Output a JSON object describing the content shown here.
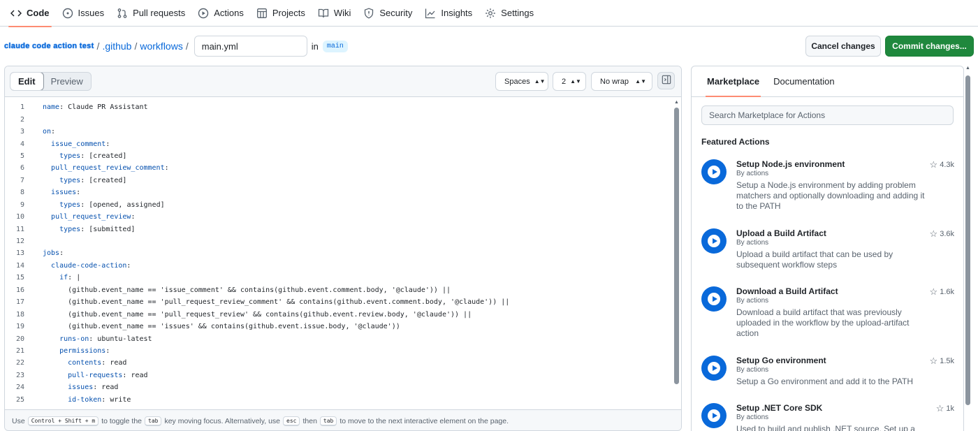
{
  "repo_nav": [
    {
      "label": "Code",
      "icon": "code-icon",
      "active": true
    },
    {
      "label": "Issues",
      "icon": "issue-icon"
    },
    {
      "label": "Pull requests",
      "icon": "pull-request-icon"
    },
    {
      "label": "Actions",
      "icon": "play-icon"
    },
    {
      "label": "Projects",
      "icon": "table-icon"
    },
    {
      "label": "Wiki",
      "icon": "book-icon"
    },
    {
      "label": "Security",
      "icon": "shield-icon"
    },
    {
      "label": "Insights",
      "icon": "graph-icon"
    },
    {
      "label": "Settings",
      "icon": "gear-icon"
    }
  ],
  "breadcrumb": {
    "repo": "claude code action test",
    "sep": "/",
    "folder1": ".github",
    "folder2": "workflows",
    "filename": "main.yml",
    "in_label": "in",
    "branch": "main"
  },
  "buttons": {
    "cancel": "Cancel changes",
    "commit": "Commit changes..."
  },
  "editor": {
    "tab_edit": "Edit",
    "tab_preview": "Preview",
    "indent_mode": "Spaces",
    "indent_size": "2",
    "wrap_mode": "No wrap",
    "lines": [
      {
        "n": "1",
        "k": "name",
        "v": " Claude PR Assistant",
        "indent": ""
      },
      {
        "n": "2",
        "k": "",
        "v": "",
        "indent": ""
      },
      {
        "n": "3",
        "k": "on",
        "v": "",
        "indent": ""
      },
      {
        "n": "4",
        "k": "issue_comment",
        "v": "",
        "indent": "  "
      },
      {
        "n": "5",
        "k": "types",
        "v": " [created]",
        "indent": "    "
      },
      {
        "n": "6",
        "k": "pull_request_review_comment",
        "v": "",
        "indent": "  "
      },
      {
        "n": "7",
        "k": "types",
        "v": " [created]",
        "indent": "    "
      },
      {
        "n": "8",
        "k": "issues",
        "v": "",
        "indent": "  "
      },
      {
        "n": "9",
        "k": "types",
        "v": " [opened, assigned]",
        "indent": "    "
      },
      {
        "n": "10",
        "k": "pull_request_review",
        "v": "",
        "indent": "  "
      },
      {
        "n": "11",
        "k": "types",
        "v": " [submitted]",
        "indent": "    "
      },
      {
        "n": "12",
        "k": "",
        "v": "",
        "indent": ""
      },
      {
        "n": "13",
        "k": "jobs",
        "v": "",
        "indent": ""
      },
      {
        "n": "14",
        "k": "claude-code-action",
        "v": "",
        "indent": "  "
      },
      {
        "n": "15",
        "k": "if",
        "v": " |",
        "indent": "    "
      },
      {
        "n": "16",
        "k": "",
        "v": "(github.event_name == 'issue_comment' && contains(github.event.comment.body, '@claude')) ||",
        "indent": "      "
      },
      {
        "n": "17",
        "k": "",
        "v": "(github.event_name == 'pull_request_review_comment' && contains(github.event.comment.body, '@claude')) ||",
        "indent": "      "
      },
      {
        "n": "18",
        "k": "",
        "v": "(github.event_name == 'pull_request_review' && contains(github.event.review.body, '@claude')) ||",
        "indent": "      "
      },
      {
        "n": "19",
        "k": "",
        "v": "(github.event_name == 'issues' && contains(github.event.issue.body, '@claude'))",
        "indent": "      "
      },
      {
        "n": "20",
        "k": "runs-on",
        "v": " ubuntu-latest",
        "indent": "    "
      },
      {
        "n": "21",
        "k": "permissions",
        "v": "",
        "indent": "    "
      },
      {
        "n": "22",
        "k": "contents",
        "v": " read",
        "indent": "      "
      },
      {
        "n": "23",
        "k": "pull-requests",
        "v": " read",
        "indent": "      "
      },
      {
        "n": "24",
        "k": "issues",
        "v": " read",
        "indent": "      "
      },
      {
        "n": "25",
        "k": "id-token",
        "v": " write",
        "indent": "      "
      }
    ],
    "footer": {
      "use": "Use",
      "shortcut": "Control + Shift + m",
      "text1": "to toggle the",
      "tab_key": "tab",
      "text2": "key moving focus. Alternatively, use",
      "esc_key": "esc",
      "then": "then",
      "tab_key2": "tab",
      "text3": "to move to the next interactive element on the page."
    }
  },
  "marketplace": {
    "tab_marketplace": "Marketplace",
    "tab_docs": "Documentation",
    "search_placeholder": "Search Marketplace for Actions",
    "featured_heading": "Featured Actions",
    "actions": [
      {
        "title": "Setup Node.js environment",
        "by": "By actions",
        "stars": "4.3k",
        "desc": "Setup a Node.js environment by adding problem matchers and optionally downloading and adding it to the PATH"
      },
      {
        "title": "Upload a Build Artifact",
        "by": "By actions",
        "stars": "3.6k",
        "desc": "Upload a build artifact that can be used by subsequent workflow steps"
      },
      {
        "title": "Download a Build Artifact",
        "by": "By actions",
        "stars": "1.6k",
        "desc": "Download a build artifact that was previously uploaded in the workflow by the upload-artifact action"
      },
      {
        "title": "Setup Go environment",
        "by": "By actions",
        "stars": "1.5k",
        "desc": "Setup a Go environment and add it to the PATH"
      },
      {
        "title": "Setup .NET Core SDK",
        "by": "By actions",
        "stars": "1k",
        "desc": "Used to build and publish .NET source. Set up a"
      }
    ]
  },
  "colors": {
    "accent": "#0969da",
    "commit_green": "#1f883d",
    "tab_underline": "#fd8c73"
  }
}
